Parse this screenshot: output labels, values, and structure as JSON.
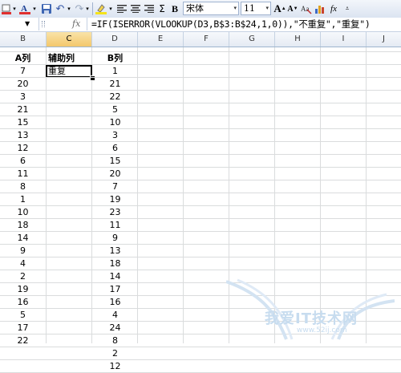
{
  "toolbar": {
    "font_name": "宋体",
    "font_size": "11",
    "bold_label": "B",
    "sum_label": "Σ",
    "grow_font_label": "A",
    "shrink_font_label": "A",
    "fx_label": "fx"
  },
  "formula_bar": {
    "fx": "fx",
    "formula": "=IF(ISERROR(VLOOKUP(D3,B$3:B$24,1,0)),\"不重复\",\"重复\")"
  },
  "columns": [
    "B",
    "C",
    "D",
    "E",
    "F",
    "G",
    "H",
    "I",
    "J"
  ],
  "selected_column": "C",
  "sheet": {
    "headers": {
      "b": "A列",
      "c": "辅助列",
      "d": "B列"
    },
    "col_b": [
      "7",
      "20",
      "3",
      "21",
      "15",
      "13",
      "12",
      "6",
      "11",
      "8",
      "1",
      "10",
      "18",
      "14",
      "9",
      "4",
      "2",
      "19",
      "16",
      "5",
      "17",
      "22"
    ],
    "col_c": [
      "重复"
    ],
    "col_d": [
      "1",
      "21",
      "22",
      "5",
      "10",
      "3",
      "6",
      "15",
      "20",
      "7",
      "19",
      "23",
      "11",
      "9",
      "13",
      "18",
      "14",
      "17",
      "16",
      "4",
      "24",
      "8",
      "2",
      "12"
    ]
  },
  "watermark": {
    "text": "我爱IT技术网",
    "url": "www.52ij.com"
  },
  "colors": {
    "selected_header": "#f3c76b",
    "grid": "#dadcdd",
    "header_border": "#9eb6ce"
  }
}
